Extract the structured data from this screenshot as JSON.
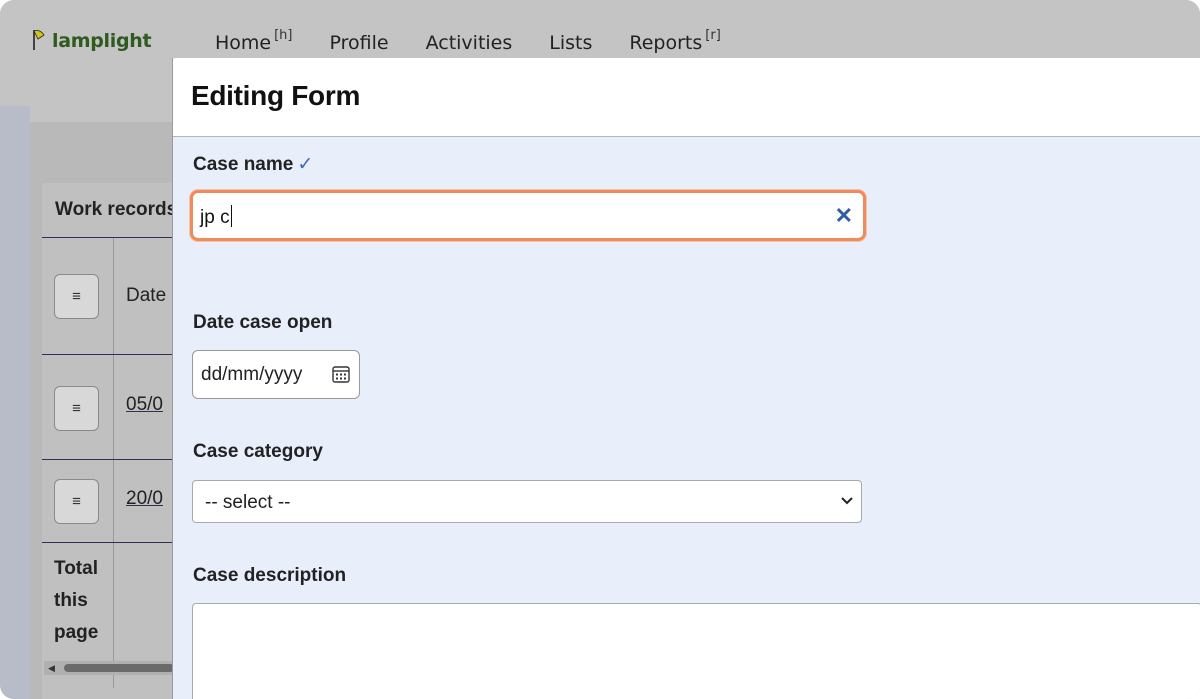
{
  "app": {
    "logo_text": "lamplight"
  },
  "nav": {
    "home": "Home",
    "home_key": "[h]",
    "profile": "Profile",
    "activities": "Activities",
    "lists": "Lists",
    "reports": "Reports",
    "reports_key": "[r]"
  },
  "background": {
    "header": "Work records",
    "column_date": "Date",
    "rows": [
      {
        "date": "05/0"
      },
      {
        "date": "20/0"
      }
    ],
    "total_line1": "Total",
    "total_line2": "this",
    "total_line3": "page",
    "menu_glyph": "≡"
  },
  "modal": {
    "title": "Editing Form",
    "case_name_label": "Case name",
    "case_name_check": "✓",
    "case_name_value": "jp c",
    "clear_glyph": "✕",
    "date_open_label": "Date case open",
    "date_placeholder": "dd/mm/yyyy",
    "category_label": "Case category",
    "category_value": "-- select --",
    "description_label": "Case description",
    "description_value": ""
  },
  "colors": {
    "focus_border": "#ef8a5a",
    "modal_bg": "#e8effb",
    "accent": "#2d5ea3",
    "logo_green": "#2f5a20"
  },
  "icons": [
    "lamp-logo-icon",
    "clear-icon",
    "calendar-icon",
    "chevron-down-icon",
    "menu-icon"
  ]
}
